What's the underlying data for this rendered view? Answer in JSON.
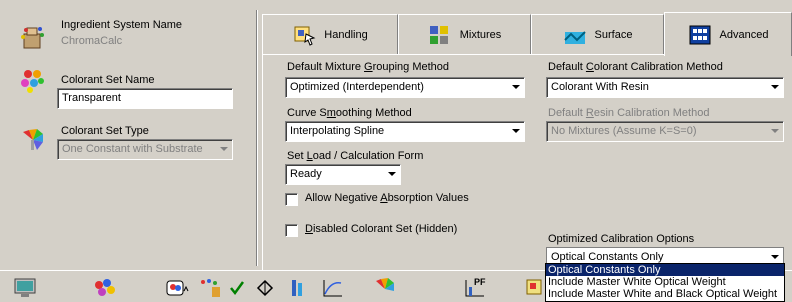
{
  "left": {
    "ingredient_system_label": "Ingredient System Name",
    "ingredient_system_value": "ChromaCalc",
    "colorant_set_name_label": "Colorant Set Name",
    "colorant_set_name_value": "Transparent",
    "colorant_set_type_label": "Colorant Set Type",
    "colorant_set_type_value": "One Constant with Substrate"
  },
  "tabs": [
    {
      "label": "Handling",
      "icon": "handling-icon"
    },
    {
      "label": "Mixtures",
      "icon": "mixtures-icon"
    },
    {
      "label": "Surface",
      "icon": "surface-icon"
    },
    {
      "label": "Advanced",
      "icon": "advanced-icon",
      "active": true
    }
  ],
  "advanced": {
    "grouping_label_pre": "Default Mixture ",
    "grouping_label_u": "G",
    "grouping_label_post": "rouping Method",
    "grouping_value": "Optimized (Interdependent)",
    "smoothing_label_pre": "Curve S",
    "smoothing_label_u": "m",
    "smoothing_label_post": "oothing Method",
    "smoothing_value": "Interpolating Spline",
    "load_label_pre": "Set ",
    "load_label_u": "L",
    "load_label_post": "oad / Calculation Form",
    "load_value": "Ready",
    "allow_negative_pre": "Allow Negative ",
    "allow_negative_u": "A",
    "allow_negative_post": "bsorption Values",
    "disabled_set_u": "D",
    "disabled_set_post": "isabled Colorant Set (Hidden)",
    "calibration_label_pre": "Default ",
    "calibration_label_u": "C",
    "calibration_label_post": "olorant Calibration Method",
    "calibration_value": "Colorant With Resin",
    "resin_label_pre": "Default ",
    "resin_label_u": "R",
    "resin_label_post": "esin Calibration Method",
    "resin_value": "No Mixtures (Assume K=S=0)",
    "optimized_label": "Optimized Calibration Options",
    "optimized_value": "Optical Constants Only",
    "optimized_options": [
      "Optical Constants Only",
      "Include Master White Optical Weight",
      "Include Master White and Black Optical Weight"
    ]
  },
  "toolbar": {
    "buttons": [
      "monitor-icon",
      "palette-icon",
      "colorant-hand-icon",
      "dots-icon",
      "check-icon",
      "diamond-icon",
      "bars-icon",
      "curve-icon",
      "fan-icon",
      "pf-icon",
      "misc-icon"
    ],
    "pf_text": "PF"
  },
  "colors": {
    "face": "#d4d0c8",
    "selection": "#0a246a"
  }
}
